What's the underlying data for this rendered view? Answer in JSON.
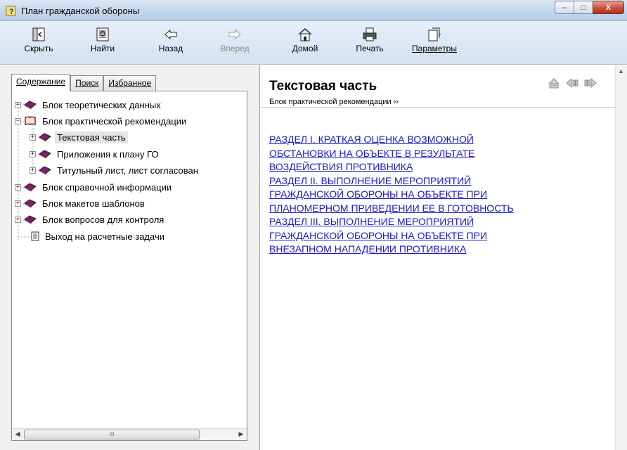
{
  "window": {
    "title": "План гражданской обороны",
    "controls": {
      "minimize": "–",
      "maximize": "□",
      "close": "X"
    }
  },
  "toolbar": {
    "buttons": [
      {
        "label": "Скрыть",
        "icon": "hide-pane-icon",
        "enabled": true
      },
      {
        "label": "Найти",
        "icon": "find-icon",
        "enabled": true
      },
      {
        "label": "Назад",
        "icon": "back-arrow-icon",
        "enabled": true
      },
      {
        "label": "Вперед",
        "icon": "forward-arrow-icon",
        "enabled": false
      },
      {
        "label": "Домой",
        "icon": "home-icon",
        "enabled": true
      },
      {
        "label": "Печать",
        "icon": "print-icon",
        "enabled": true
      },
      {
        "label": "Параметры",
        "icon": "options-icon",
        "enabled": true
      }
    ]
  },
  "nav_tabs": [
    {
      "label": "Содержание",
      "active": true
    },
    {
      "label": "Поиск",
      "active": false
    },
    {
      "label": "Избранное",
      "active": false
    }
  ],
  "tree": [
    {
      "label": "Блок теоретических данных",
      "expander": "+",
      "icon": "closed-book-icon"
    },
    {
      "label": "Блок практической рекомендации",
      "expander": "−",
      "icon": "open-book-icon"
    },
    {
      "label": "Текстовая часть",
      "expander": "+",
      "icon": "closed-book-icon",
      "selected": true
    },
    {
      "label": "Приложения к плану ГО",
      "expander": "+",
      "icon": "closed-book-icon"
    },
    {
      "label": "Титульный лист, лист согласован",
      "expander": "+",
      "icon": "closed-book-icon"
    },
    {
      "label": "Блок справочной информации",
      "expander": "+",
      "icon": "closed-book-icon"
    },
    {
      "label": "Блок макетов шаблонов",
      "expander": "+",
      "icon": "closed-book-icon"
    },
    {
      "label": "Блок вопросов для контроля",
      "expander": "+",
      "icon": "closed-book-icon"
    },
    {
      "label": "Выход на расчетные задачи",
      "expander": "",
      "icon": "page-icon"
    }
  ],
  "hscroll": {
    "thumb_grip": "III"
  },
  "topic": {
    "title": "Текстовая часть",
    "breadcrumb": "Блок практической рекомендации ››",
    "links": [
      "РАЗДЕЛ I. КРАТКАЯ ОЦЕНКА ВОЗМОЖНОЙ",
      "ОБСТАНОВКИ НА ОБЪЕКТЕ В РЕЗУЛЬТАТЕ",
      "ВОЗДЕЙСТВИЯ ПРОТИВНИКА",
      "РАЗДЕЛ II. ВЫПОЛНЕНИЕ МЕРОПРИЯТИЙ",
      "ГРАЖДАНСКОЙ ОБОРОНЫ НА ОБЪЕКТЕ ПРИ",
      "ПЛАНОМЕРНОМ ПРИВЕДЕНИИ ЕЕ В ГОТОВНОСТЬ",
      "РАЗДЕЛ III. ВЫПОЛНЕНИЕ МЕРОПРИЯТИЙ",
      "ГРАЖДАНСКОЙ ОБОРОНЫ НА ОБЪЕКТЕ ПРИ",
      "ВНЕЗАПНОМ НАПАДЕНИИ ПРОТИВНИКА"
    ]
  },
  "colors": {
    "link": "#1a1ac8",
    "book": "#7b1f6a",
    "titlebar": "#c3d6ee"
  }
}
